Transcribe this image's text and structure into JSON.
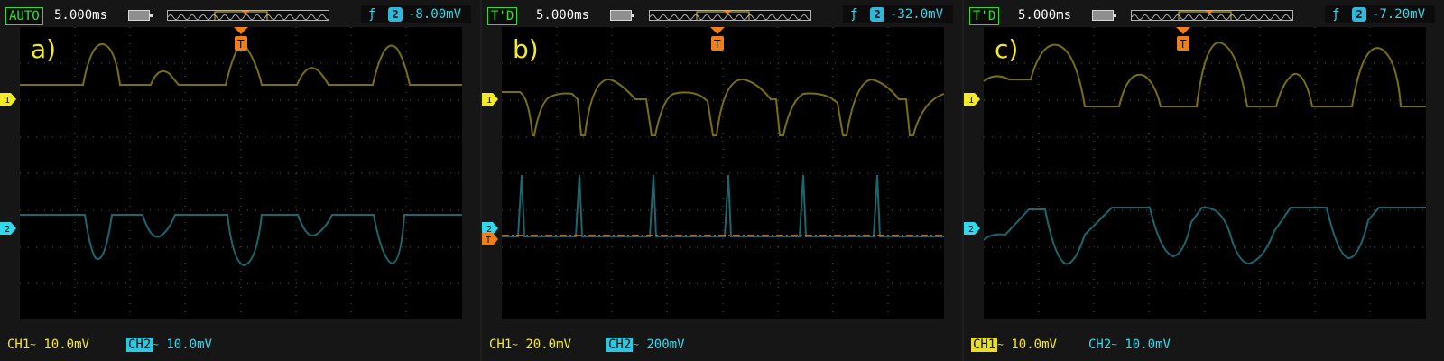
{
  "panels": [
    {
      "id": "a",
      "mode": "AUTO",
      "timebase": "5.000ms",
      "trigger_level": "-8.00mV",
      "trigger_channel": "2",
      "panel_label": "a)",
      "ch1_label": "CH1",
      "ch1_scale": "10.0mV",
      "ch2_label": "CH2",
      "ch2_scale": "10.0mV",
      "trigger_position": 0.5,
      "ch1_marker": 0.25,
      "ch2_marker": 0.69
    },
    {
      "id": "b",
      "mode": "T'D",
      "timebase": "5.000ms",
      "trigger_level": "-32.0mV",
      "trigger_channel": "2",
      "panel_label": "b)",
      "ch1_label": "CH1",
      "ch1_scale": "20.0mV",
      "ch2_label": "CH2",
      "ch2_scale": "200mV",
      "trigger_position": 0.5,
      "ch1_marker": 0.25,
      "ch2_marker": 0.69,
      "trigger_line": 0.71
    },
    {
      "id": "c",
      "mode": "T'D",
      "timebase": "5.000ms",
      "trigger_level": "-7.20mV",
      "trigger_channel": "2",
      "panel_label": "c)",
      "ch1_label": "CH1",
      "ch1_scale": "10.0mV",
      "ch2_label": "CH2",
      "ch2_scale": "10.0mV",
      "trigger_position": 0.5,
      "ch1_marker": 0.25,
      "ch2_marker": 0.69
    }
  ],
  "icons": {
    "battery": "battery-icon",
    "memory": "memory-depth-icon",
    "trigger": "trigger-marker-icon",
    "channel1": "channel-1-marker-icon",
    "channel2": "channel-2-marker-icon",
    "slope": "rising-edge-icon"
  },
  "colors": {
    "ch1": "#f4ea25",
    "ch2": "#32d9ea",
    "trigger": "#f07f1b",
    "grid": "#6c6c6c",
    "mode": "#2ee02e"
  }
}
